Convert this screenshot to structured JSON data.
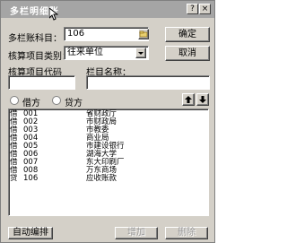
{
  "window": {
    "title": "多栏明细账",
    "help_glyph": "?",
    "close_glyph": "×"
  },
  "form": {
    "account_label": "多栏账科目：",
    "account_value": "106",
    "category_label": "核算项目类别：",
    "category_value": "往来单位",
    "item_code_label": "核算项目代码",
    "item_code_value": "",
    "column_name_label": "栏目名称：",
    "column_name_value": ""
  },
  "buttons": {
    "ok": "确定",
    "cancel": "取消",
    "auto_arrange": "自动编排",
    "add": "增加",
    "delete": "删除"
  },
  "direction": {
    "debit_label": "借方",
    "credit_label": "贷方",
    "selected": "借方"
  },
  "list_rows": [
    {
      "dir": "借",
      "code": "001",
      "name": "省财政厅"
    },
    {
      "dir": "借",
      "code": "002",
      "name": "市财政局"
    },
    {
      "dir": "借",
      "code": "003",
      "name": "市教委"
    },
    {
      "dir": "借",
      "code": "004",
      "name": "商业局"
    },
    {
      "dir": "借",
      "code": "005",
      "name": "市建设银行"
    },
    {
      "dir": "借",
      "code": "006",
      "name": "湖海大学"
    },
    {
      "dir": "借",
      "code": "007",
      "name": "东大印刷厂"
    },
    {
      "dir": "借",
      "code": "008",
      "name": "万东商场"
    },
    {
      "dir": "贷",
      "code": "106",
      "name": "应收账款"
    }
  ]
}
